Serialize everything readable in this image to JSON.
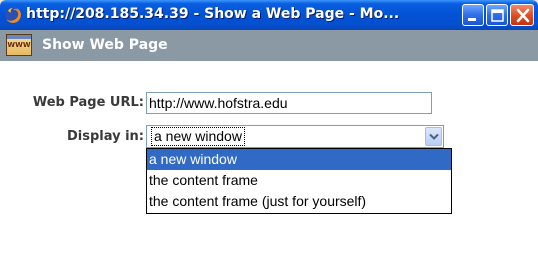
{
  "window": {
    "title": "http://208.185.34.39 - Show a Web Page - Mo...",
    "icon": "firefox-icon",
    "buttons": [
      "minimize",
      "maximize",
      "close"
    ]
  },
  "header": {
    "icon_label": "WWW",
    "title": "Show Web Page"
  },
  "form": {
    "url_label": "Web Page URL:",
    "url_value": "http://www.hofstra.edu",
    "display_label": "Display in:",
    "display_selected": "a new window",
    "display_options": [
      "a new window",
      "the content frame",
      "the content frame (just for yourself)"
    ]
  },
  "colors": {
    "titlebar": "#0353d6",
    "header_bar": "#8a99a4",
    "selection": "#316ac5",
    "close_button": "#de4a22"
  }
}
